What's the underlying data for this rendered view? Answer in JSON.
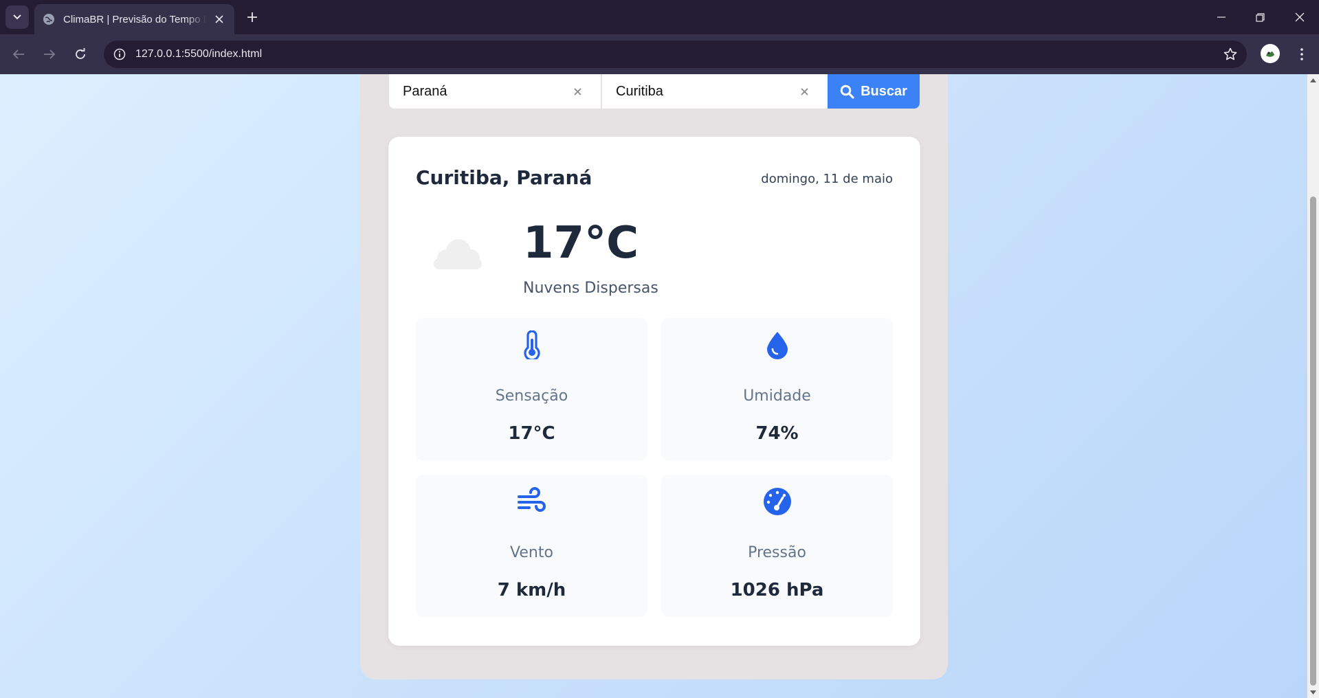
{
  "browser": {
    "tab_title": "ClimaBR | Previsão do Tempo Intelligence",
    "url": "127.0.0.1:5500/index.html"
  },
  "search": {
    "state_value": "Paraná",
    "city_value": "Curitiba",
    "button_label": "Buscar"
  },
  "weather": {
    "location": "Curitiba, Paraná",
    "date": "domingo, 11 de maio",
    "temperature": "17°C",
    "condition": "Nuvens Dispersas",
    "icon": "cloud-icon"
  },
  "metrics": [
    {
      "label": "Sensação",
      "value": "17°C",
      "icon": "thermometer-icon"
    },
    {
      "label": "Umidade",
      "value": "74%",
      "icon": "droplet-icon"
    },
    {
      "label": "Vento",
      "value": "7 km/h",
      "icon": "wind-icon"
    },
    {
      "label": "Pressão",
      "value": "1026 hPa",
      "icon": "gauge-icon"
    }
  ],
  "colors": {
    "accent": "#3b82f6",
    "icon_blue": "#2563eb",
    "browser_frame": "#241c33",
    "container": "#e6e1e2"
  }
}
